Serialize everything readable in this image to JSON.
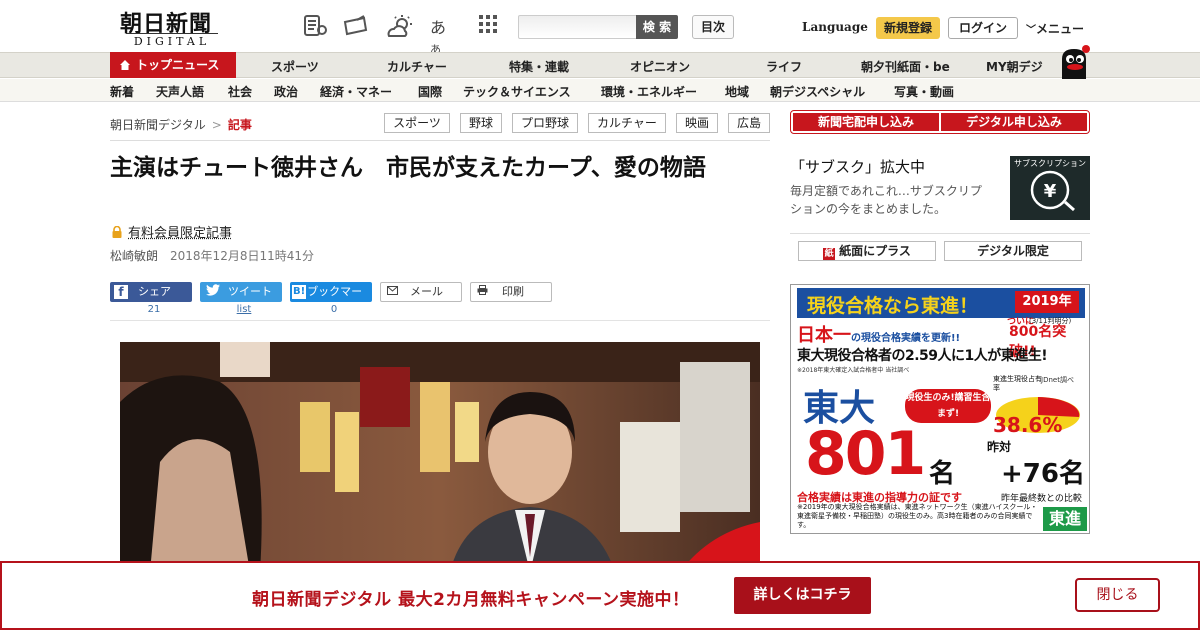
{
  "header": {
    "logo_main": "朝日新聞",
    "logo_sub": "DIGITAL",
    "search_placeholder": "",
    "search_button": "検 索",
    "toc_button": "目次",
    "language": "Language",
    "signup": "新規登録",
    "login": "ログイン",
    "menu": "メニュー"
  },
  "nav_primary": [
    "トップニュース",
    "スポーツ",
    "カルチャー",
    "特集・連載",
    "オピニオン",
    "ライフ",
    "朝夕刊紙面・be",
    "MY朝デジ"
  ],
  "nav_secondary": [
    "新着",
    "天声人語",
    "社会",
    "政治",
    "経済・マネー",
    "国際",
    "テック＆サイエンス",
    "環境・エネルギー",
    "地域",
    "朝デジスペシャル",
    "写真・動画"
  ],
  "breadcrumb": {
    "home": "朝日新聞デジタル",
    "sep": ">",
    "current": "記事"
  },
  "tags": [
    "スポーツ",
    "野球",
    "プロ野球",
    "カルチャー",
    "映画",
    "広島"
  ],
  "article": {
    "title": "主演はチュート徳井さん　市民が支えたカープ、愛の物語",
    "paid_label": "有料会員限定記事",
    "author": "松崎敏朗",
    "date": "2018年12月8日11時41分"
  },
  "share": {
    "facebook": "シェア",
    "facebook_count": "21",
    "twitter": "ツイート",
    "twitter_count": "list",
    "hatena": "ブックマーク",
    "hatena_icon": "B!",
    "hatena_count": "0",
    "mail": "メール",
    "print": "印刷"
  },
  "sidebar": {
    "subscribe_paper": "新聞宅配申し込み",
    "subscribe_digital": "デジタル申し込み",
    "promo_title": "「サブスク」拡大中",
    "promo_desc": "毎月定額であれこれ…サブスクリプションの今をまとめました。",
    "promo_image_text": "サブスクリプション",
    "button_plus": "紙面にプラス",
    "button_digital": "デジタル限定"
  },
  "ad": {
    "headline": "現役合格なら東進！",
    "year": "2019年",
    "line1": "日本一",
    "line1b": "の現役合格実績を更新!!",
    "count_note_a": "ついに",
    "count_note": "800名突破!!",
    "date_note": "(3/11判明分)",
    "line2": "東大現役合格者の2.59人に1人が東進生!",
    "small_note": "※2018年東大確定入試合格者中 当社調べ",
    "school": "東大",
    "number": "801",
    "unit": "名",
    "badge": "現役生のみ!講習生含まず!",
    "pie_label": "東進生現役占有率",
    "pie_source": "JDnet調べ",
    "percent": "38.6%",
    "comparison": "昨対",
    "increase": "+76名",
    "tagline": "合格実績は東進の指導力の証です",
    "tagline2": "昨年最終数との比較",
    "fine_print": "※2019年の東大現役合格実績は、東進ネットワーク生（東進ハイスクール・東進衛星予備校・早稲田塾）の現役生のみ。高3時在籍者のみの合同実績です。",
    "brand": "東進",
    "colors": {
      "blue": "#1b4fa0",
      "red": "#d7141a",
      "yellow": "#f5d21b"
    }
  },
  "banner": {
    "text": "朝日新聞デジタル 最大2カ月無料キャンペーン実施中！",
    "cta": "詳しくはコチラ",
    "close": "閉じる"
  },
  "colors": {
    "brand_red": "#c7161d",
    "signup_yellow": "#f4c84a"
  }
}
